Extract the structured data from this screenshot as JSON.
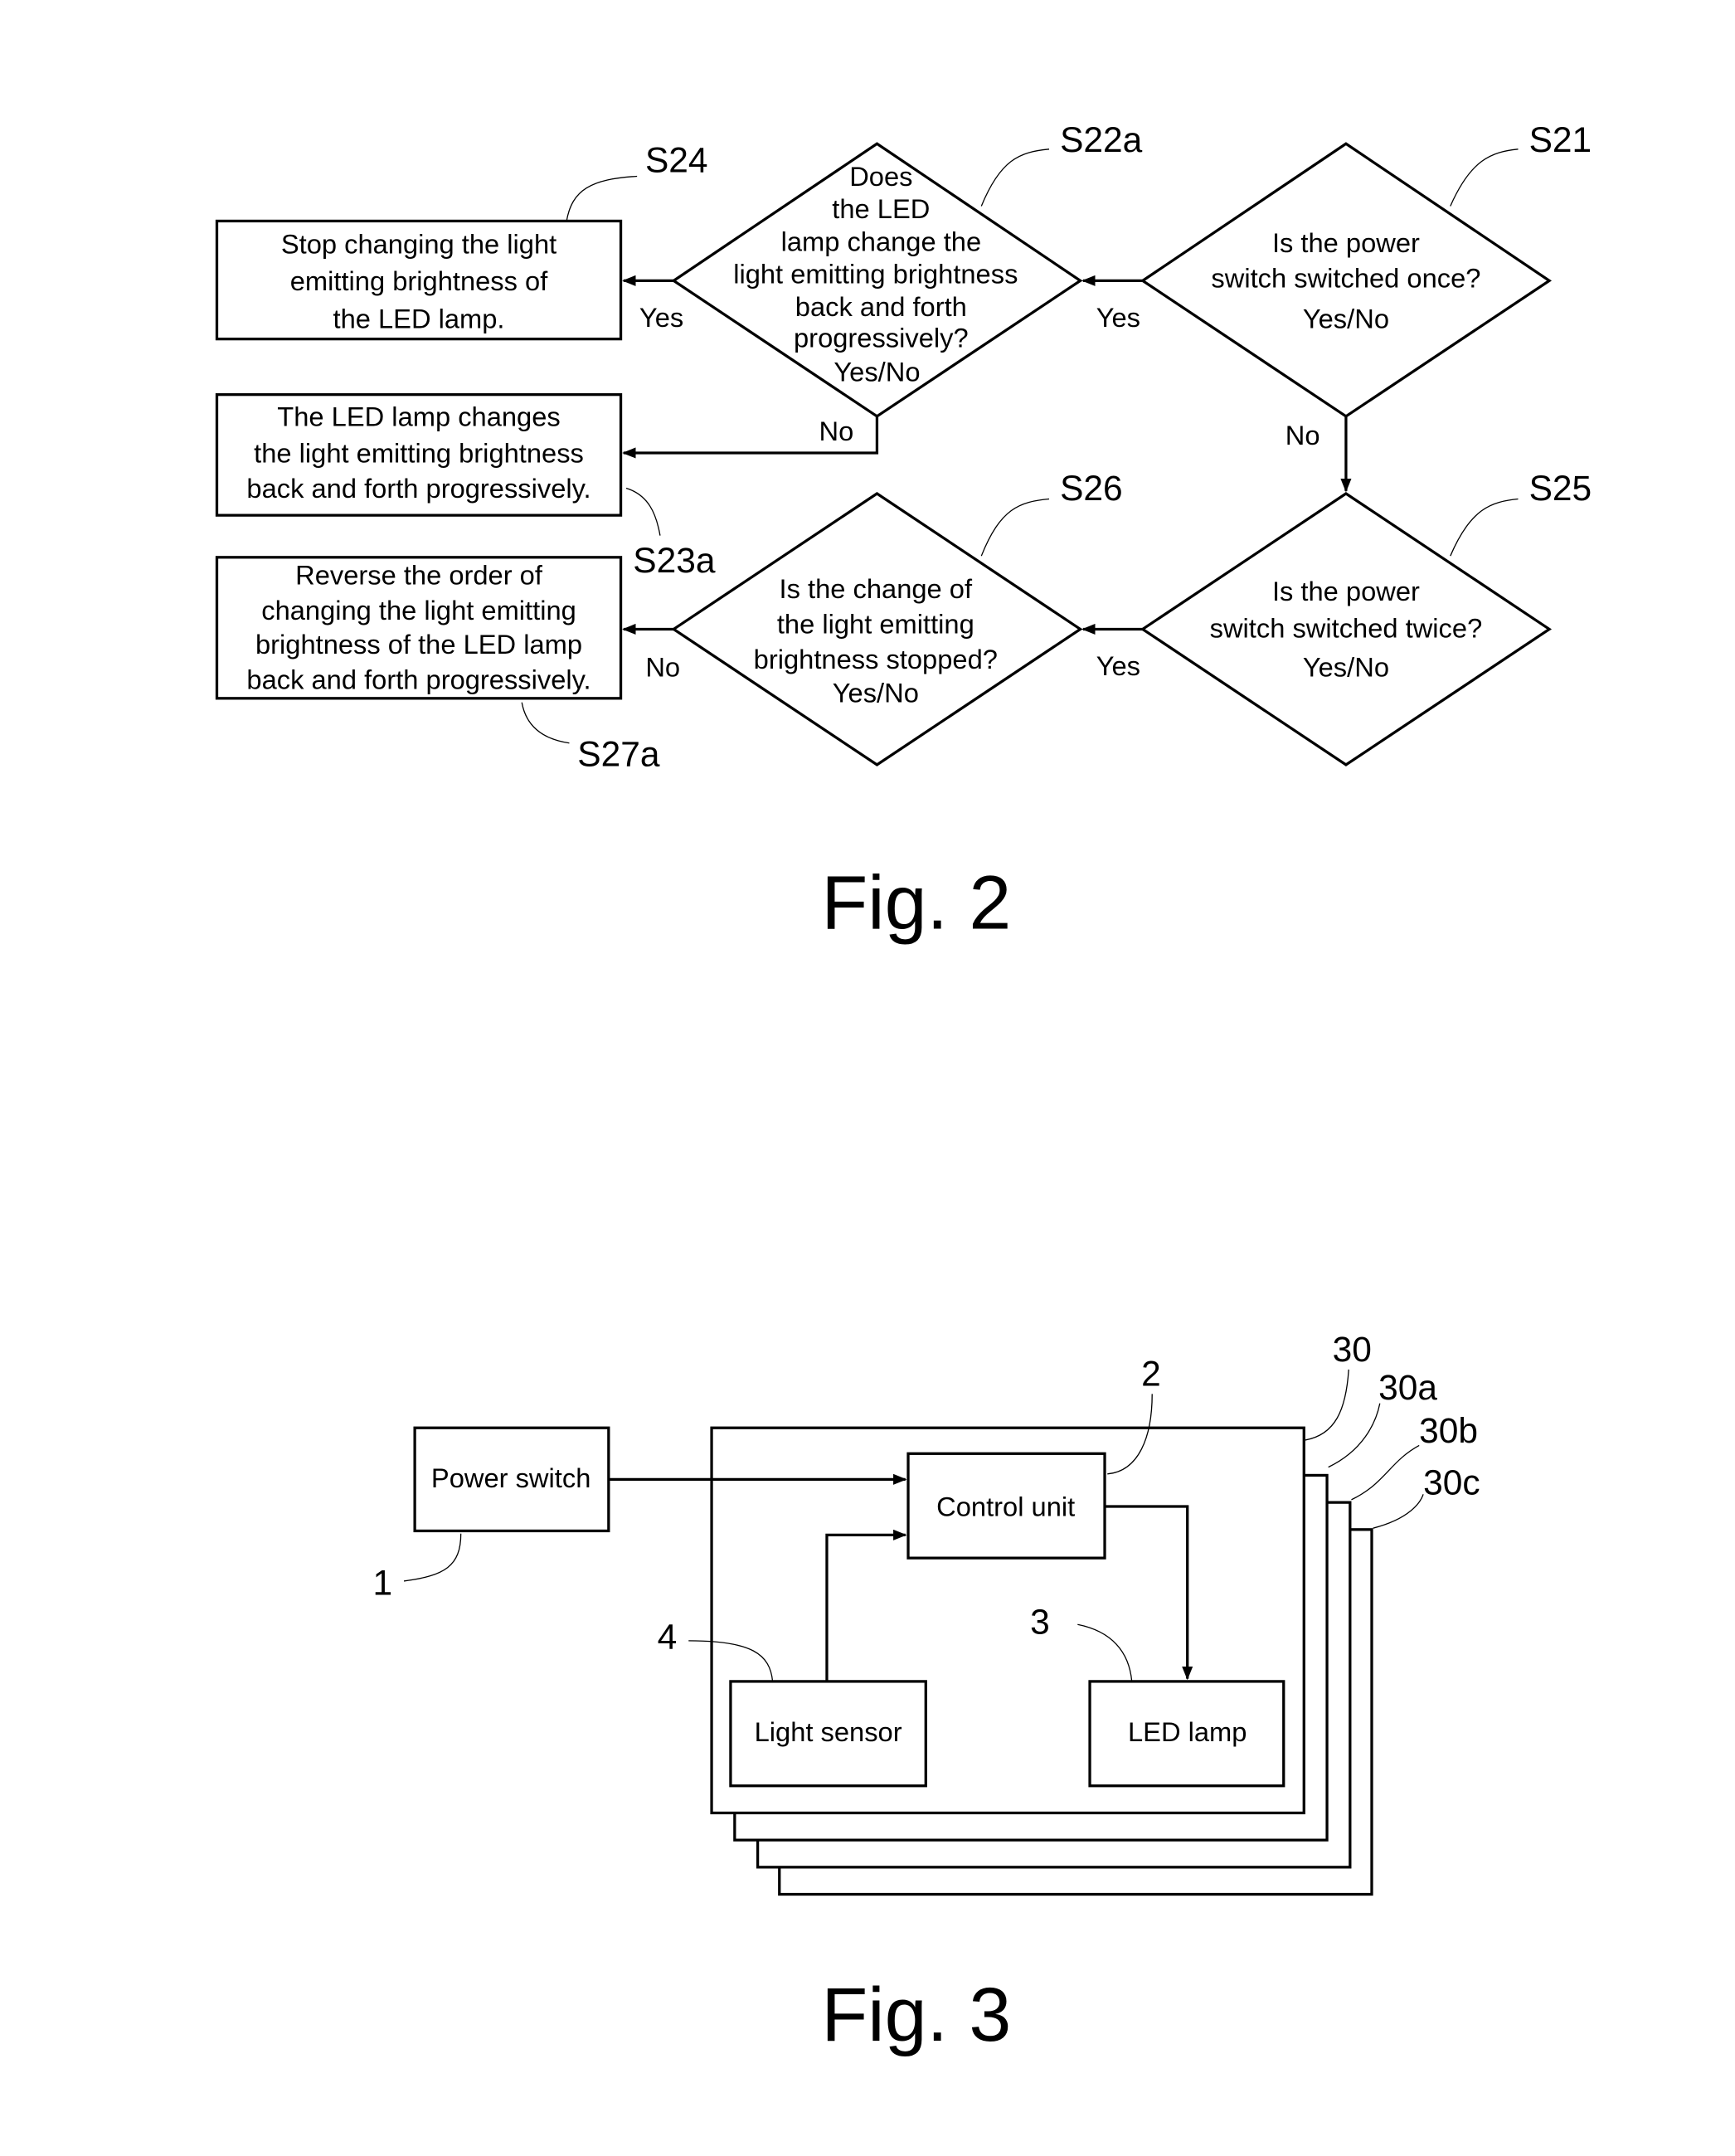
{
  "fig2": {
    "caption": "Fig. 2",
    "steps": {
      "s21": {
        "ref": "S21",
        "lines": [
          "Is the power",
          "switch switched once?",
          "Yes/No"
        ]
      },
      "s22a": {
        "ref": "S22a",
        "lines": [
          "Does",
          "the LED",
          "lamp change the",
          "light emitting brightness",
          "back and forth",
          "progressively?",
          "Yes/No"
        ]
      },
      "s23a": {
        "ref": "S23a",
        "lines": [
          "The LED lamp changes",
          "the light emitting brightness",
          "back and forth progressively."
        ]
      },
      "s24": {
        "ref": "S24",
        "lines": [
          "Stop changing the light",
          "emitting brightness of",
          "the LED lamp."
        ]
      },
      "s25": {
        "ref": "S25",
        "lines": [
          "Is the power",
          "switch switched twice?",
          "Yes/No"
        ]
      },
      "s26": {
        "ref": "S26",
        "lines": [
          "Is the change of",
          "the light emitting",
          "brightness stopped?",
          "Yes/No"
        ]
      },
      "s27a": {
        "ref": "S27a",
        "lines": [
          "Reverse the order of",
          "changing the light emitting",
          "brightness of the LED lamp",
          "back and forth progressively."
        ]
      }
    },
    "edges": {
      "s21_yes": "Yes",
      "s21_no": "No",
      "s22a_yes": "Yes",
      "s22a_no": "No",
      "s25_yes": "Yes",
      "s26_no": "No"
    }
  },
  "fig3": {
    "caption": "Fig. 3",
    "blocks": {
      "power_switch": {
        "label": "Power switch",
        "ref": "1"
      },
      "control_unit": {
        "label": "Control unit",
        "ref": "2"
      },
      "led_lamp": {
        "label": "LED lamp",
        "ref": "3"
      },
      "light_sensor": {
        "label": "Light sensor",
        "ref": "4"
      }
    },
    "layers": [
      "30",
      "30a",
      "30b",
      "30c"
    ]
  }
}
